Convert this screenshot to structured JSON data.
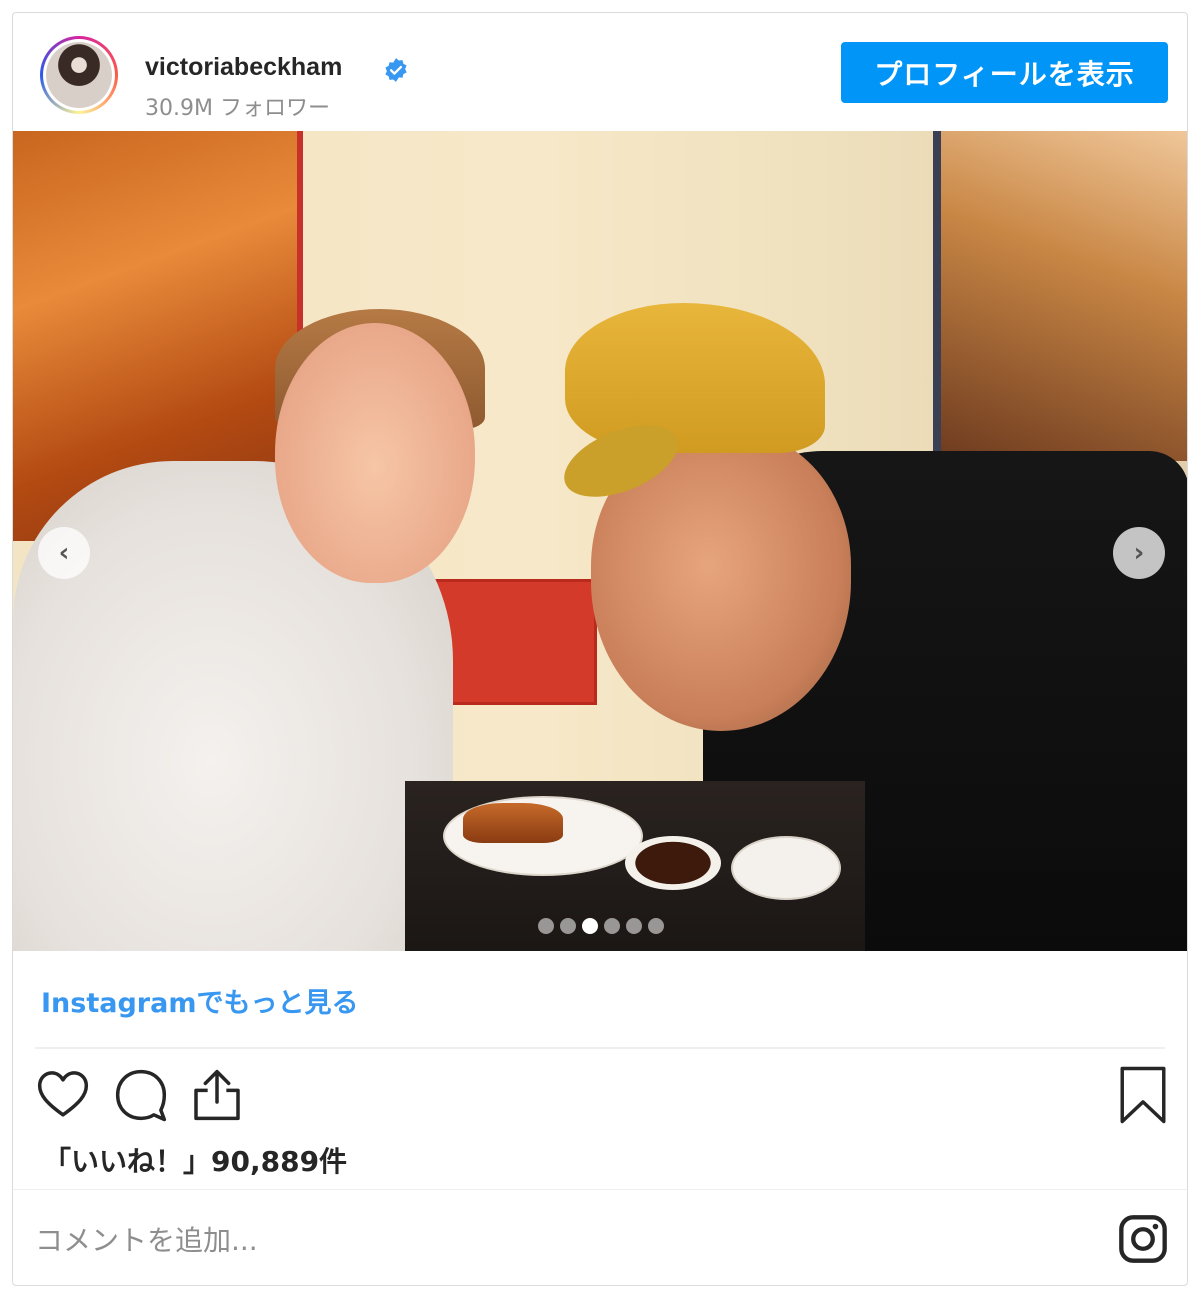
{
  "header": {
    "username": "victoriabeckham",
    "followers": "30.9M フォロワー",
    "profile_button": "プロフィールを表示",
    "verified_icon": "verified-badge-icon"
  },
  "photo": {
    "prev_icon": "chevron-left-icon",
    "next_icon": "chevron-right-icon",
    "prev_glyph": "‹",
    "next_glyph": "›",
    "carousel_total": 6,
    "carousel_active": 3
  },
  "more_link": "Instagramでもっと見る",
  "actions": {
    "like_icon": "heart-icon",
    "comment_icon": "comment-icon",
    "share_icon": "share-icon",
    "bookmark_icon": "bookmark-icon"
  },
  "likes": "「いいね！」90,889件",
  "comment": {
    "placeholder": "コメントを追加..."
  },
  "footer_icon": "instagram-logo-icon",
  "colors": {
    "accent": "#0095f6",
    "link": "#3897f0",
    "text": "#262626",
    "muted": "#8e8e8e"
  }
}
